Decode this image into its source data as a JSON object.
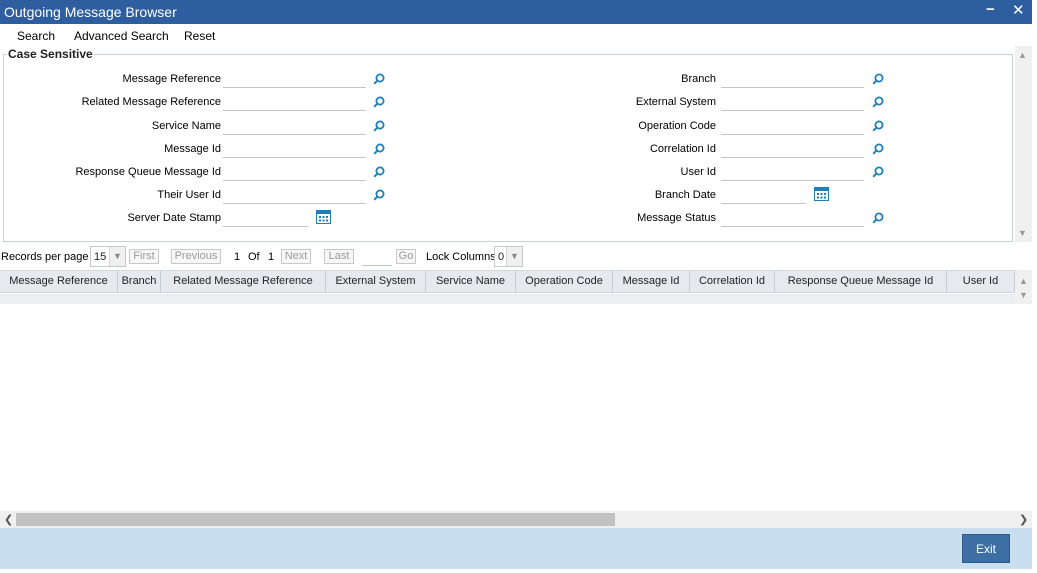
{
  "window": {
    "title": "Outgoing Message Browser",
    "minimize_glyph": "−",
    "close_glyph": "✕"
  },
  "toolbar": {
    "search": "Search",
    "advanced_search": "Advanced Search",
    "reset": "Reset"
  },
  "criteria": {
    "legend": "Case Sensitive",
    "left_fields": [
      {
        "label": "Message Reference",
        "value": "",
        "icon": "search-icon"
      },
      {
        "label": "Related Message Reference",
        "value": "",
        "icon": "search-icon"
      },
      {
        "label": "Service Name",
        "value": "",
        "icon": "search-icon"
      },
      {
        "label": "Message Id",
        "value": "",
        "icon": "search-icon"
      },
      {
        "label": "Response Queue Message Id",
        "value": "",
        "icon": "search-icon"
      },
      {
        "label": "Their User Id",
        "value": "",
        "icon": "search-icon"
      },
      {
        "label": "Server Date Stamp",
        "value": "",
        "icon": "calendar-icon"
      }
    ],
    "right_fields": [
      {
        "label": "Branch",
        "value": "",
        "icon": "search-icon"
      },
      {
        "label": "External System",
        "value": "",
        "icon": "search-icon"
      },
      {
        "label": "Operation Code",
        "value": "",
        "icon": "search-icon"
      },
      {
        "label": "Correlation Id",
        "value": "",
        "icon": "search-icon"
      },
      {
        "label": "User Id",
        "value": "",
        "icon": "search-icon"
      },
      {
        "label": "Branch Date",
        "value": "",
        "icon": "calendar-icon"
      },
      {
        "label": "Message Status",
        "value": "",
        "icon": "search-icon"
      }
    ]
  },
  "pager": {
    "records_per_page_label": "Records per page",
    "records_per_page_value": "15",
    "first": "First",
    "previous": "Previous",
    "current_page": "1",
    "of_label": "Of",
    "total_pages": "1",
    "next": "Next",
    "last": "Last",
    "go": "Go",
    "lock_columns_label": "Lock Columns",
    "lock_columns_value": "0"
  },
  "grid": {
    "columns": [
      "Message Reference",
      "Branch",
      "Related Message Reference",
      "External System",
      "Service Name",
      "Operation Code",
      "Message Id",
      "Correlation Id",
      "Response Queue Message Id",
      "User Id"
    ],
    "rows": []
  },
  "footer": {
    "exit": "Exit"
  },
  "colors": {
    "titlebar": "#2e5e9f",
    "footer": "#c9dff0",
    "exit_button": "#3d6fa5",
    "icon_accent": "#1f7fb8"
  }
}
